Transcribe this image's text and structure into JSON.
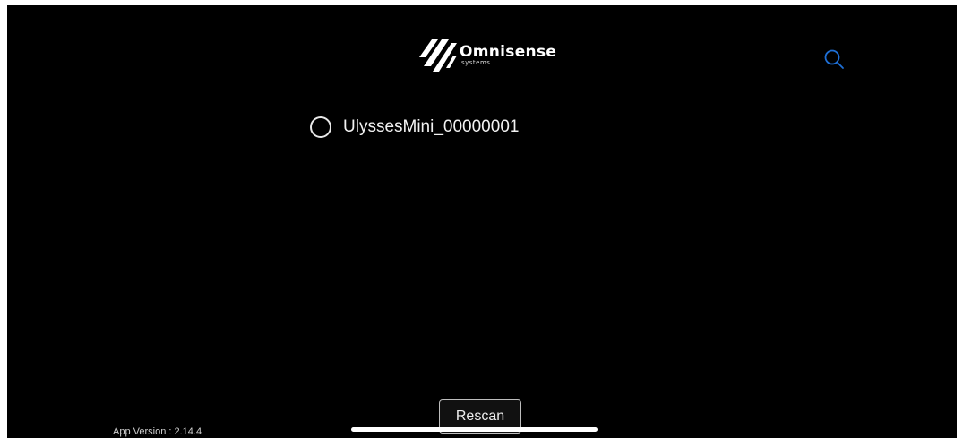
{
  "header": {
    "logo_name": "Omnisense",
    "logo_sub": "systems",
    "search_icon": "search-icon",
    "accent_color": "#1e6fd6"
  },
  "devices": [
    {
      "label": "UlyssesMini_00000001",
      "selected": false
    }
  ],
  "footer": {
    "version_text": "App Version : 2.14.4",
    "rescan_label": "Rescan"
  },
  "colors": {
    "background": "#000000",
    "text": "#ffffff"
  }
}
